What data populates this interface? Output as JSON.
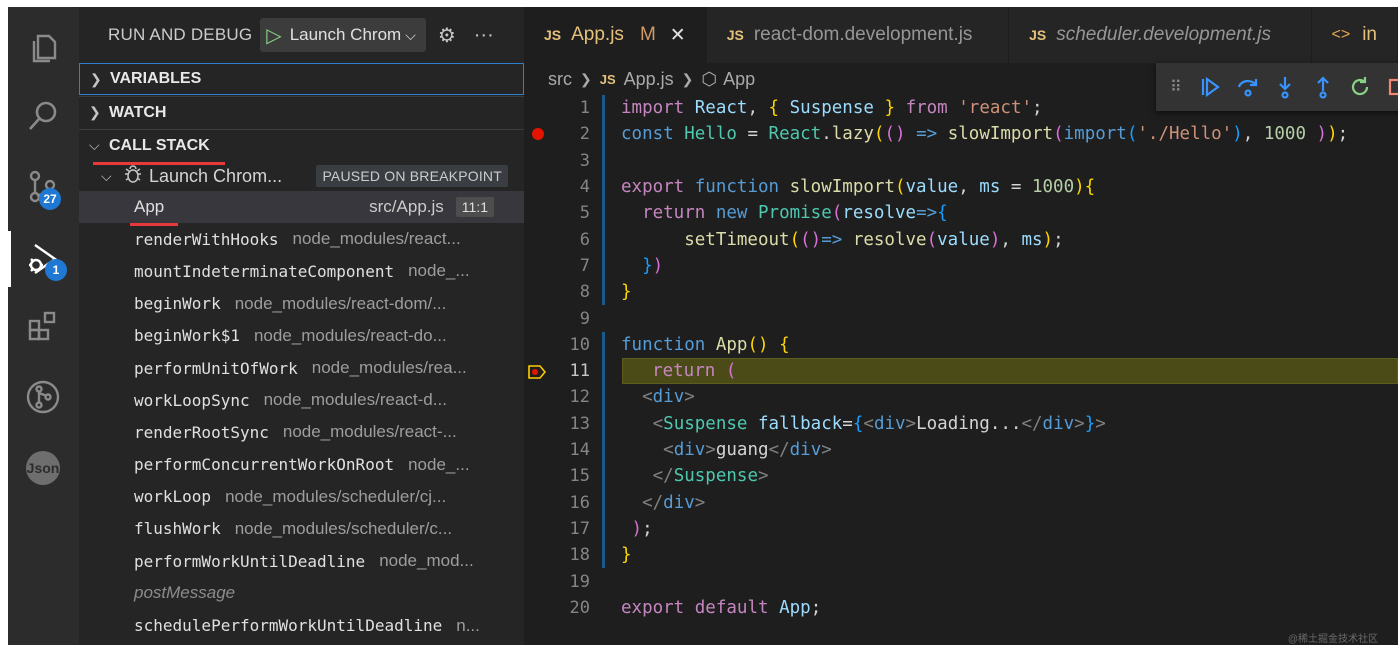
{
  "sidebar": {
    "title": "RUN AND DEBUG",
    "launch_config": "Launch Chrom",
    "sections": {
      "variables": "VARIABLES",
      "watch": "WATCH",
      "call_stack": "CALL STACK"
    },
    "thread": {
      "name": "Launch Chrom...",
      "status": "PAUSED ON BREAKPOINT"
    },
    "frames": [
      {
        "fn": "App",
        "path": "src/App.js",
        "pos": "11:1"
      },
      {
        "fn": "renderWithHooks",
        "path": "node_modules/react..."
      },
      {
        "fn": "mountIndeterminateComponent",
        "path": "node_..."
      },
      {
        "fn": "beginWork",
        "path": "node_modules/react-dom/..."
      },
      {
        "fn": "beginWork$1",
        "path": "node_modules/react-do..."
      },
      {
        "fn": "performUnitOfWork",
        "path": "node_modules/rea..."
      },
      {
        "fn": "workLoopSync",
        "path": "node_modules/react-d..."
      },
      {
        "fn": "renderRootSync",
        "path": "node_modules/react-..."
      },
      {
        "fn": "performConcurrentWorkOnRoot",
        "path": "node_..."
      },
      {
        "fn": "workLoop",
        "path": "node_modules/scheduler/cj..."
      },
      {
        "fn": "flushWork",
        "path": "node_modules/scheduler/c..."
      },
      {
        "fn": "performWorkUntilDeadline",
        "path": "node_mod..."
      },
      {
        "fn": "postMessage",
        "path": ""
      },
      {
        "fn": "schedulePerformWorkUntilDeadline",
        "path": "n..."
      }
    ]
  },
  "activity": {
    "badges": {
      "source_control": "27",
      "debug": "1"
    },
    "json_label": "Json"
  },
  "tabs": [
    {
      "name": "App.js",
      "badge": "M",
      "active": true
    },
    {
      "name": "react-dom.development.js",
      "active": false
    },
    {
      "name": "scheduler.development.js",
      "active": false
    },
    {
      "name": "in",
      "active": false
    }
  ],
  "breadcrumb": {
    "folder": "src",
    "file": "App.js",
    "symbol": "App"
  },
  "editor": {
    "current_line": 11,
    "breakpoint_lines": [
      2,
      11
    ],
    "line_numbers": [
      "1",
      "2",
      "3",
      "4",
      "5",
      "6",
      "7",
      "8",
      "9",
      "10",
      "11",
      "12",
      "13",
      "14",
      "15",
      "16",
      "17",
      "18",
      "19",
      "20"
    ]
  },
  "watermark": "@稀土掘金技术社区"
}
